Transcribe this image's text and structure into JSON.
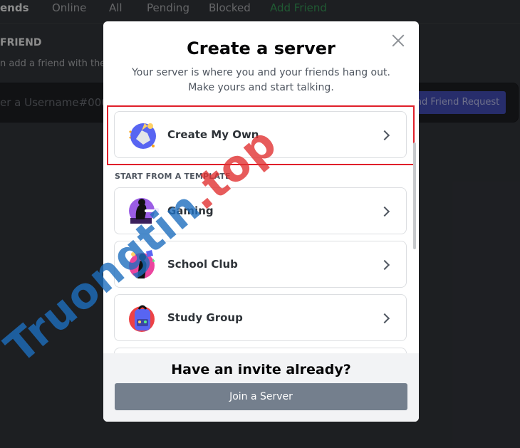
{
  "background": {
    "tabs": [
      {
        "label": "ends",
        "style": "strong"
      },
      {
        "label": "Online",
        "style": "normal"
      },
      {
        "label": "All",
        "style": "normal"
      },
      {
        "label": "Pending",
        "style": "normal"
      },
      {
        "label": "Blocked",
        "style": "normal"
      },
      {
        "label": "Add Friend",
        "style": "green"
      }
    ],
    "heading": "FRIEND",
    "subtext": "n add a friend with their D",
    "input_placeholder": "er a Username#000",
    "send_button": "nd Friend Request"
  },
  "modal": {
    "title": "Create a server",
    "subtitle": "Your server is where you and your friends hang out. Make yours and start talking.",
    "primary_option": "Create My Own",
    "section_label": "START FROM A TEMPLATE",
    "templates": [
      {
        "label": "Gaming"
      },
      {
        "label": "School Club"
      },
      {
        "label": "Study Group"
      }
    ],
    "footer_title": "Have an invite already?",
    "join_button": "Join a Server"
  },
  "watermark": {
    "part1": "Truongtin",
    "part2": ".top"
  },
  "colors": {
    "accent_red": "#e01f2a",
    "button_gray": "#747f8d",
    "add_friend_green": "#3ba55d",
    "blurple": "#4752c4"
  }
}
